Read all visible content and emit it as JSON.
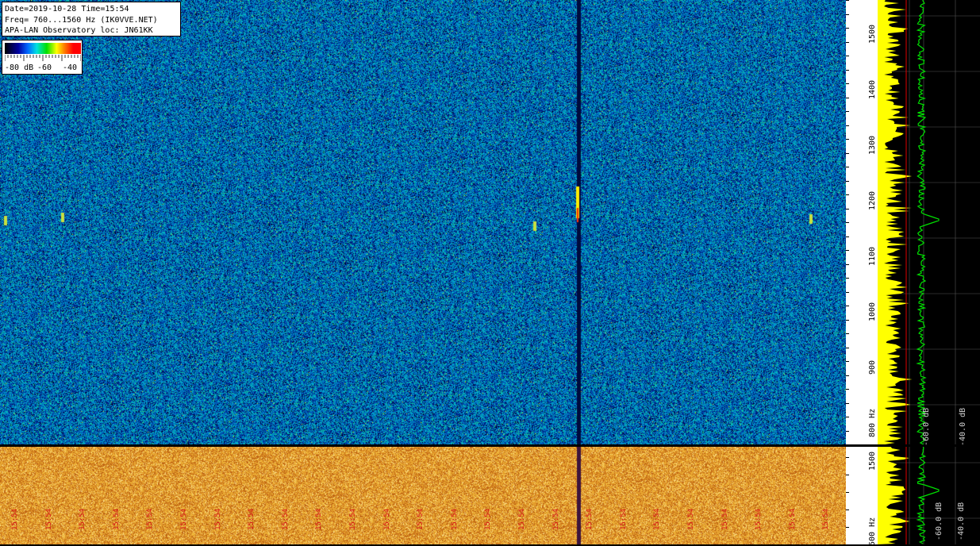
{
  "info": {
    "line1": "Date=2019-10-28 Time=15:54",
    "line2": "Freq= 760...1560 Hz (IK0VVE.NET)",
    "line3": "APA-LAN Observatory loc: JN61KK"
  },
  "legend": {
    "label_low": "-80 dB",
    "label_mid": "-60",
    "label_high": "-40"
  },
  "axis_top": {
    "labels": [
      {
        "text": "1500",
        "freq": 1500
      },
      {
        "text": "1400",
        "freq": 1400
      },
      {
        "text": "1300",
        "freq": 1300
      },
      {
        "text": "1200",
        "freq": 1200
      },
      {
        "text": "1100",
        "freq": 1100
      },
      {
        "text": "1000",
        "freq": 1000
      },
      {
        "text": "900",
        "freq": 900
      },
      {
        "text": "800 Hz",
        "freq": 800
      }
    ]
  },
  "axis_bottom": {
    "labels": [
      {
        "text": "1500",
        "freq": 1500
      },
      {
        "text": "500 Hz",
        "freq": 500
      }
    ]
  },
  "spectrum": {
    "top_labels": [
      "-60.0 dB",
      "-40.0 dB"
    ],
    "bottom_labels": [
      "-60.0 dB",
      "-40.0 dB"
    ]
  },
  "timestamps": [
    "15:54",
    "15:54",
    "15:54",
    "15:54",
    "15:54",
    "15:54",
    "15:54",
    "15:54",
    "15:54",
    "15:54",
    "15:54",
    "15:54",
    "15:54",
    "15:54",
    "15:54",
    "15:54",
    "15:54",
    "15:54",
    "15:54",
    "15:54",
    "15:54",
    "15:54",
    "15:54",
    "15:54",
    "15:54"
  ],
  "colors": {
    "trace_yellow": "#ffff00",
    "trace_green": "#00e000",
    "trace_red": "#e00000",
    "waterfall_bottom": "#e8a020"
  }
}
